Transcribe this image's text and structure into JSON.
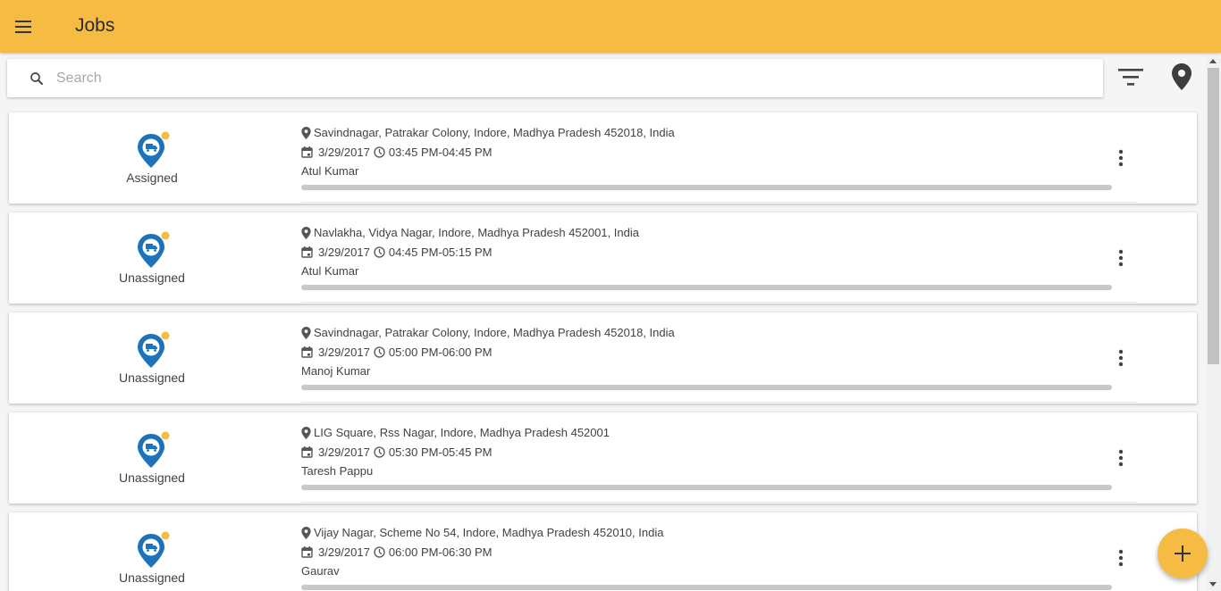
{
  "header": {
    "title": "Jobs",
    "menu_icon": "menu-icon"
  },
  "search": {
    "placeholder": "Search",
    "value": ""
  },
  "toolbar": {
    "filter_icon": "filter-icon",
    "location_icon": "location-pin-icon"
  },
  "colors": {
    "accent": "#f6bb42",
    "status_icon": "#1e73b8",
    "status_dot": "#f6bb42"
  },
  "jobs": [
    {
      "status": "Assigned",
      "address": "Savindnagar, Patrakar Colony, Indore, Madhya Pradesh 452018, India",
      "date": "3/29/2017",
      "time": "03:45 PM-04:45 PM",
      "worker": "Atul Kumar"
    },
    {
      "status": "Unassigned",
      "address": "Navlakha, Vidya Nagar, Indore, Madhya Pradesh 452001, India",
      "date": "3/29/2017",
      "time": "04:45 PM-05:15 PM",
      "worker": "Atul Kumar"
    },
    {
      "status": "Unassigned",
      "address": "Savindnagar, Patrakar Colony, Indore, Madhya Pradesh 452018, India",
      "date": "3/29/2017",
      "time": "05:00 PM-06:00 PM",
      "worker": "Manoj Kumar"
    },
    {
      "status": "Unassigned",
      "address": "LIG Square, Rss Nagar, Indore, Madhya Pradesh 452001",
      "date": "3/29/2017",
      "time": "05:30 PM-05:45 PM",
      "worker": "Taresh Pappu"
    },
    {
      "status": "Unassigned",
      "address": "Vijay Nagar, Scheme No 54, Indore, Madhya Pradesh 452010, India",
      "date": "3/29/2017",
      "time": "06:00 PM-06:30 PM",
      "worker": "Gaurav"
    }
  ],
  "fab": {
    "icon": "plus-icon"
  }
}
